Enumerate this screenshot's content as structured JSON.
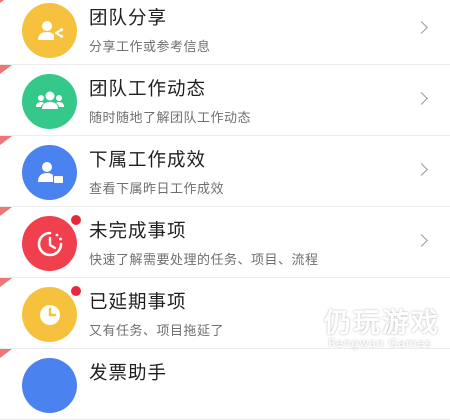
{
  "colors": {
    "orange": "#f6c23e",
    "green": "#34c98b",
    "blue": "#4a82ef",
    "red": "#f0404e",
    "badge": "#e8283a",
    "corner": "#f07575"
  },
  "items": [
    {
      "title": "团队分享",
      "subtitle": "分享工作或参考信息",
      "icon": "share-person-icon",
      "badge": false
    },
    {
      "title": "团队工作动态",
      "subtitle": "随时随地了解团队工作动态",
      "icon": "team-group-icon",
      "badge": false
    },
    {
      "title": "下属工作成效",
      "subtitle": "查看下属昨日工作成效",
      "icon": "subordinate-report-icon",
      "badge": false
    },
    {
      "title": "未完成事项",
      "subtitle": "快速了解需要处理的任务、项目、流程",
      "icon": "pending-clock-icon",
      "badge": true
    },
    {
      "title": "已延期事项",
      "subtitle": "又有任务、项目拖延了",
      "icon": "delayed-clock-icon",
      "badge": true
    },
    {
      "title": "发票助手",
      "subtitle": "",
      "icon": "invoice-icon",
      "badge": false
    }
  ],
  "watermark": {
    "title": "仍玩游戏",
    "subtitle": "Rengwan Games"
  }
}
